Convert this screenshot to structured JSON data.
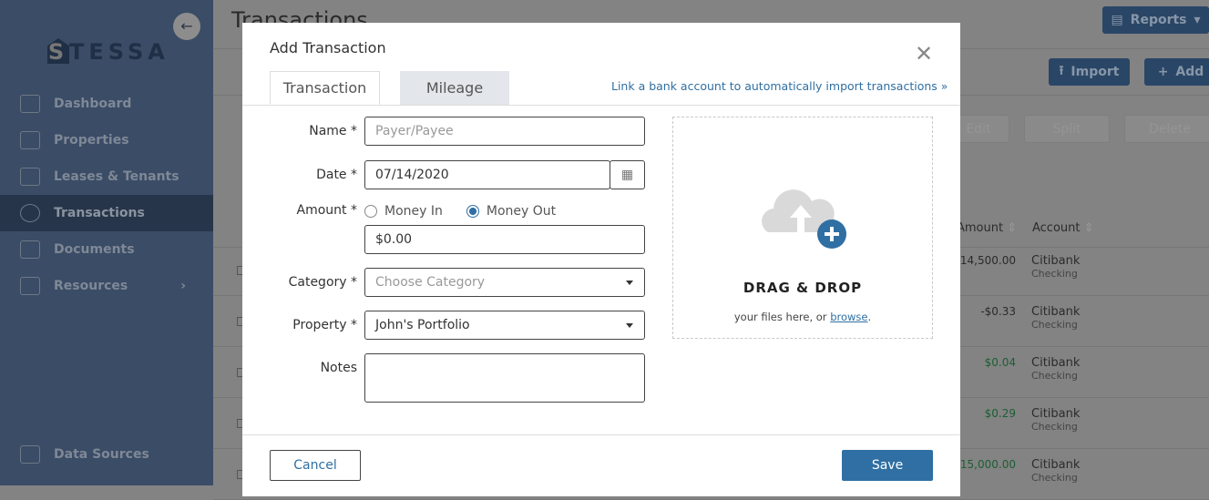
{
  "sidebar": {
    "logo": "STESSA",
    "items": [
      {
        "label": "Dashboard",
        "icon": "dashboard-icon"
      },
      {
        "label": "Properties",
        "icon": "building-icon"
      },
      {
        "label": "Leases & Tenants",
        "icon": "tenants-icon"
      },
      {
        "label": "Transactions",
        "icon": "transactions-icon",
        "active": true
      },
      {
        "label": "Documents",
        "icon": "folder-icon"
      },
      {
        "label": "Resources",
        "icon": "book-icon"
      }
    ],
    "data_sources": "Data Sources"
  },
  "page": {
    "title": "Transactions",
    "reports": "Reports",
    "import": "Import",
    "add": "Add",
    "edit": "Edit",
    "split": "Split",
    "delete": "Delete",
    "columns": {
      "amount": "Amount",
      "account": "Account"
    },
    "rows": [
      {
        "amount": "$14,500.00",
        "account": "Citibank",
        "sub": "Checking",
        "positive": false
      },
      {
        "amount": "-$0.33",
        "account": "Citibank",
        "sub": "Checking",
        "positive": false
      },
      {
        "amount": "$0.04",
        "account": "Citibank",
        "sub": "Checking",
        "positive": true
      },
      {
        "amount": "$0.29",
        "account": "Citibank",
        "sub": "Checking",
        "positive": true
      },
      {
        "amount": "$15,000.00",
        "account": "Citibank",
        "sub": "Checking",
        "positive": true
      }
    ]
  },
  "modal": {
    "title": "Add Transaction",
    "tabs": [
      "Transaction",
      "Mileage"
    ],
    "link": "Link a bank account to automatically import transactions »",
    "labels": {
      "name": "Name *",
      "date": "Date *",
      "amount": "Amount *",
      "category": "Category *",
      "property": "Property *",
      "notes": "Notes"
    },
    "name_placeholder": "Payer/Payee",
    "date_value": "07/14/2020",
    "money_in": "Money In",
    "money_out": "Money Out",
    "money_selected": "Money Out",
    "amount_value": "$0.00",
    "category_placeholder": "Choose Category",
    "property_value": "John's Portfolio",
    "drop_title": "DRAG & DROP",
    "drop_text": "your files here, or ",
    "browse": "browse",
    "drop_end": ".",
    "cancel": "Cancel",
    "save": "Save"
  },
  "colors": {
    "accent": "#2f6fa3",
    "positive": "#1c5e32"
  }
}
